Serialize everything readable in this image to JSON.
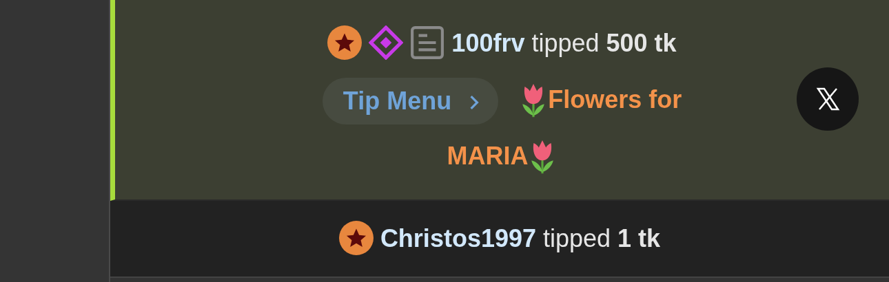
{
  "messages": [
    {
      "highlighted": true,
      "badges": [
        {
          "kind": "star"
        },
        {
          "kind": "diamond"
        },
        {
          "kind": "notes"
        }
      ],
      "username": "100frv",
      "action": "tipped",
      "amount": "500 tk",
      "tip_menu": {
        "label": "Tip Menu"
      },
      "note_lines": [
        "Flowers for",
        "MARIA"
      ],
      "closable": true
    },
    {
      "highlighted": false,
      "badges": [
        {
          "kind": "star"
        }
      ],
      "username": "Christos1997",
      "action": "tipped",
      "amount": "1 tk",
      "closable": false
    }
  ]
}
